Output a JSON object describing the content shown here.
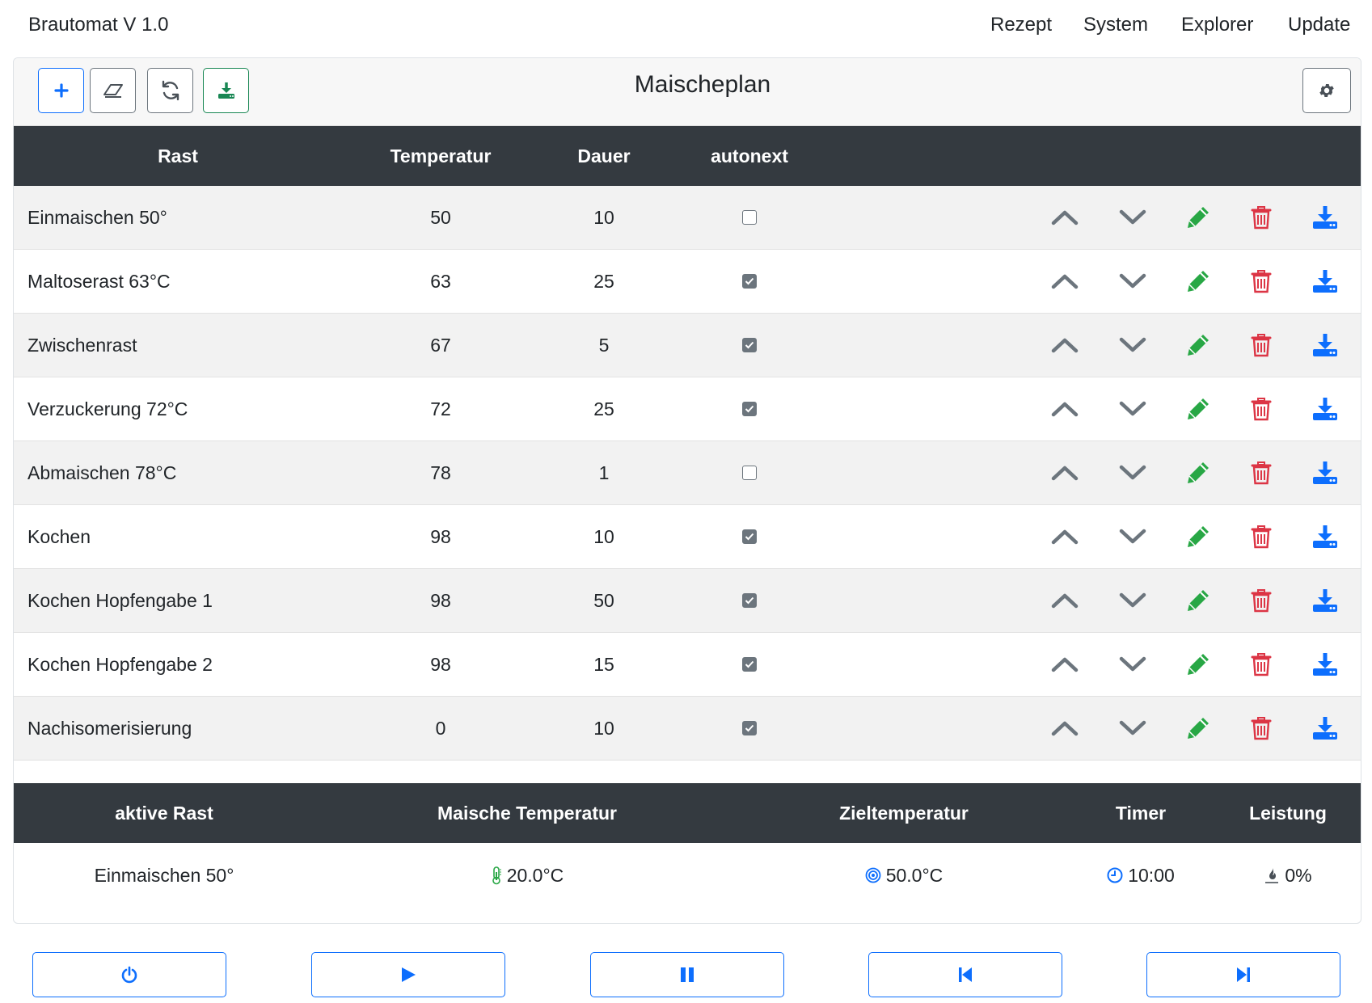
{
  "navbar": {
    "brand": "Brautomat V 1.0",
    "items": [
      {
        "label": "Rezept"
      },
      {
        "label": "System"
      },
      {
        "label": "Explorer"
      },
      {
        "label": "Update"
      }
    ]
  },
  "toolbar": {
    "title": "Maischeplan",
    "buttons": [
      {
        "icon": "plus-icon",
        "color": "#0d6efd"
      },
      {
        "icon": "eraser-icon",
        "color": "#6c757d"
      },
      {
        "icon": "refresh-icon",
        "color": "#6c757d"
      },
      {
        "icon": "download-icon",
        "color": "#198754"
      }
    ],
    "settings_icon": "gear-icon"
  },
  "mash_table": {
    "headers": {
      "rast": "Rast",
      "temperatur": "Temperatur",
      "dauer": "Dauer",
      "autonext": "autonext"
    },
    "rows": [
      {
        "rast": "Einmaischen 50°",
        "temperatur": "50",
        "dauer": "10",
        "autonext": false
      },
      {
        "rast": "Maltoserast 63°C",
        "temperatur": "63",
        "dauer": "25",
        "autonext": true
      },
      {
        "rast": "Zwischenrast",
        "temperatur": "67",
        "dauer": "5",
        "autonext": true
      },
      {
        "rast": "Verzuckerung 72°C",
        "temperatur": "72",
        "dauer": "25",
        "autonext": true
      },
      {
        "rast": "Abmaischen 78°C",
        "temperatur": "78",
        "dauer": "1",
        "autonext": false
      },
      {
        "rast": "Kochen",
        "temperatur": "98",
        "dauer": "10",
        "autonext": true
      },
      {
        "rast": "Kochen Hopfengabe 1",
        "temperatur": "98",
        "dauer": "50",
        "autonext": true
      },
      {
        "rast": "Kochen Hopfengabe 2",
        "temperatur": "98",
        "dauer": "15",
        "autonext": true
      },
      {
        "rast": "Nachisomerisierung",
        "temperatur": "0",
        "dauer": "10",
        "autonext": true
      }
    ],
    "row_actions": [
      "chevron-up-icon",
      "chevron-down-icon",
      "pencil-icon",
      "trash-icon",
      "download-icon"
    ],
    "action_colors": {
      "move": "#6c757d",
      "edit": "#28a745",
      "delete": "#dc3545",
      "download": "#0d6efd"
    }
  },
  "status_table": {
    "headers": {
      "active": "aktive Rast",
      "mash_temp": "Maische Temperatur",
      "target_temp": "Zieltemperatur",
      "timer": "Timer",
      "power": "Leistung"
    },
    "values": {
      "active": "Einmaischen 50°",
      "mash_temp": "20.0°C",
      "target_temp": "50.0°C",
      "timer": "10:00",
      "power": "0%"
    }
  },
  "controls": [
    {
      "icon": "power-icon"
    },
    {
      "icon": "play-icon"
    },
    {
      "icon": "pause-icon"
    },
    {
      "icon": "skip-back-icon"
    },
    {
      "icon": "skip-forward-icon"
    }
  ],
  "colors": {
    "header_dark": "#343a40",
    "primary": "#0d6efd",
    "success": "#198754",
    "danger": "#dc3545",
    "muted": "#6c757d"
  }
}
